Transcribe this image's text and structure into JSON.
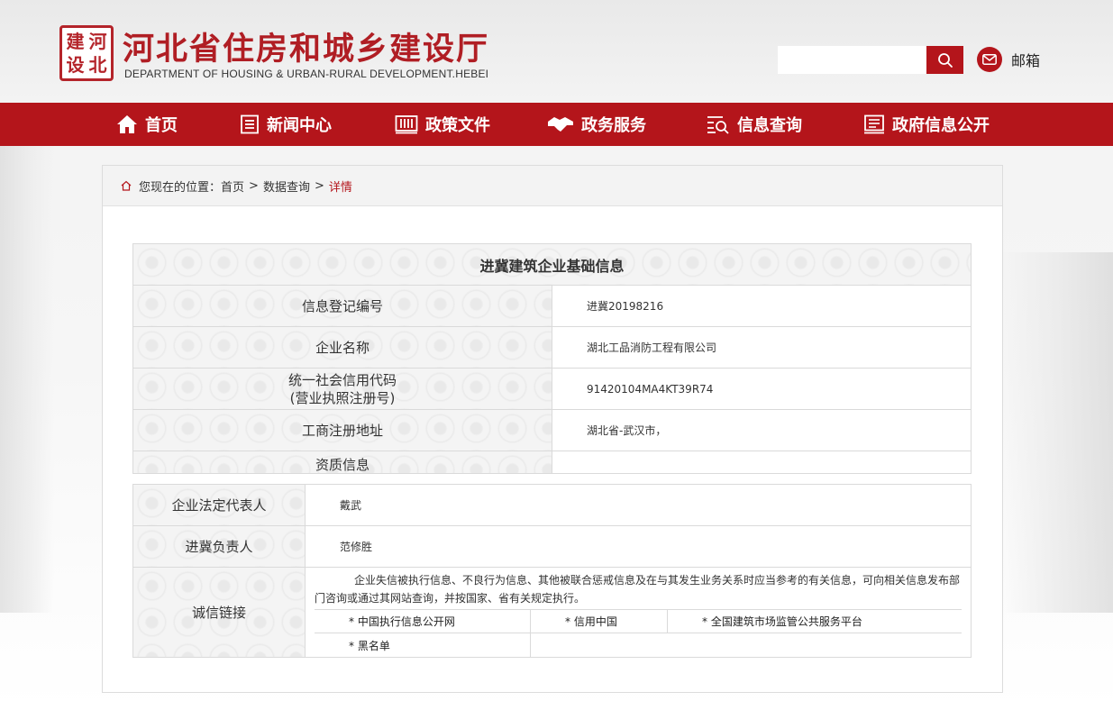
{
  "header": {
    "logo_chars": [
      "建",
      "河",
      "设",
      "北"
    ],
    "title": "河北省住房和城乡建设厅",
    "subtitle": "DEPARTMENT OF HOUSING & URBAN-RURAL DEVELOPMENT.HEBEI",
    "search_placeholder": "",
    "mail_label": "邮箱"
  },
  "nav": {
    "items": [
      {
        "label": "首页",
        "icon": "home-icon"
      },
      {
        "label": "新闻中心",
        "icon": "news-icon"
      },
      {
        "label": "政策文件",
        "icon": "policy-icon"
      },
      {
        "label": "政务服务",
        "icon": "handshake-icon"
      },
      {
        "label": "信息查询",
        "icon": "search-list-icon"
      },
      {
        "label": "政府信息公开",
        "icon": "gov-info-icon"
      }
    ]
  },
  "breadcrumb": {
    "prefix": "您现在的位置：",
    "home": "首页",
    "section": "数据查询",
    "current": "详情",
    "sep": ">"
  },
  "table": {
    "caption": "进冀建筑企业基础信息",
    "rows": [
      {
        "label": "信息登记编号",
        "value": "进冀20198216"
      },
      {
        "label": "企业名称",
        "value": "湖北工品消防工程有限公司"
      },
      {
        "label": "统一社会信用代码",
        "label2": "(营业执照注册号)",
        "value": "91420104MA4KT39R74"
      },
      {
        "label": "工商注册地址",
        "value": "湖北省-武汉市，"
      },
      {
        "label": "资质信息",
        "value": ""
      }
    ]
  },
  "table2": {
    "rows": [
      {
        "label": "企业法定代表人",
        "value": "戴武"
      },
      {
        "label": "进冀负责人",
        "value": "范修胜"
      }
    ],
    "credit": {
      "label": "诚信链接",
      "text": "企业失信被执行信息、不良行为信息、其他被联合惩戒信息及在与其发生业务关系时应当参考的有关信息，可向相关信息发布部门咨询或通过其网站查询，并按国家、省有关规定执行。",
      "links": [
        "* 中国执行信息公开网",
        "* 信用中国",
        "* 全国建筑市场监管公共服务平台",
        "* 黑名单"
      ]
    }
  },
  "colors": {
    "brand_red": "#b4151b",
    "title_red": "#b01e24"
  }
}
